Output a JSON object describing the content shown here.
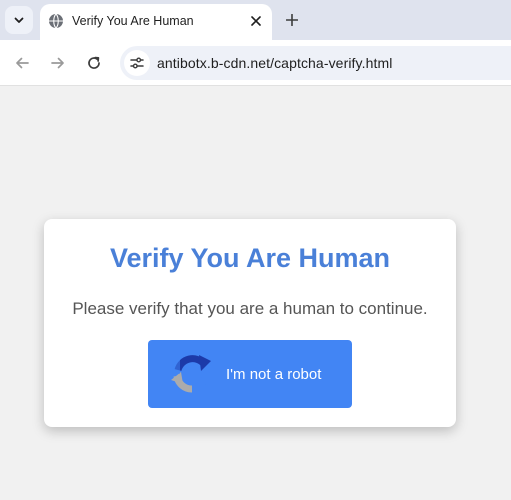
{
  "browser": {
    "tab": {
      "title": "Verify You Are Human",
      "favicon": "globe-icon"
    },
    "address_bar": {
      "url": "antibotx.b-cdn.net/captcha-verify.html"
    }
  },
  "page": {
    "heading": "Verify You Are Human",
    "message": "Please verify that you are a human to continue.",
    "verify_button": {
      "label": "I'm not a robot",
      "icon": "recaptcha-icon"
    }
  },
  "colors": {
    "heading": "#4a80d8",
    "button_bg": "#4285f4",
    "page_bg": "#f1f1f1"
  }
}
